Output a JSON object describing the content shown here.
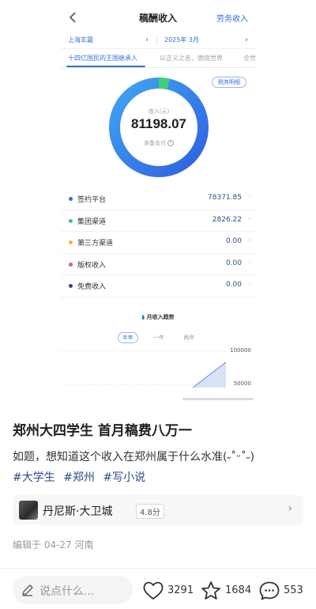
{
  "screenshot": {
    "header": {
      "title": "稿酬收入",
      "right_link": "劳务收入"
    },
    "pickers": {
      "left": "上海玄霆",
      "right": "2025年 3月"
    },
    "tabs": [
      "十四亿国民的王国继承人",
      "以正义之名，燃烧世界",
      "全世"
    ],
    "tax_button": "税务明细",
    "donut": {
      "label": "收入(元)",
      "value": "81198.07",
      "sub": "准备支付",
      "primary_color": "#3a78e8",
      "secondary_color": "#3ccf7a",
      "secondary_fraction": 0.035
    },
    "breakdown": [
      {
        "name": "签约平台",
        "value": "78371.85",
        "color": "#2f6fd6"
      },
      {
        "name": "集团渠道",
        "value": "2826.22",
        "color": "#39c68a"
      },
      {
        "name": "第三方渠道",
        "value": "0.00",
        "color": "#f2b632"
      },
      {
        "name": "版权收入",
        "value": "0.00",
        "color": "#e0577a"
      },
      {
        "name": "免费收入",
        "value": "0.00",
        "color": "#3a3d9c"
      }
    ],
    "trend": {
      "title": "月收入趋势",
      "ranges": [
        "半年",
        "一年",
        "两年"
      ],
      "active_range": "半年",
      "y_labels": [
        "100000",
        "50000"
      ]
    }
  },
  "post": {
    "title": "郑州大四学生 首月稿费八万一",
    "body": "如题，想知道这个收入在郑州属于什么水准(˶˚ᵕ˚˶)",
    "tags": [
      "#大学生",
      "#郑州",
      "#写小说"
    ],
    "location": {
      "name": "丹尼斯·大卫城",
      "rating": "4.8分"
    },
    "edit_meta": "编辑于 04-27 河南"
  },
  "bottom_bar": {
    "comment_placeholder": "说点什么...",
    "likes": "3291",
    "favorites": "1684",
    "comments": "553"
  }
}
